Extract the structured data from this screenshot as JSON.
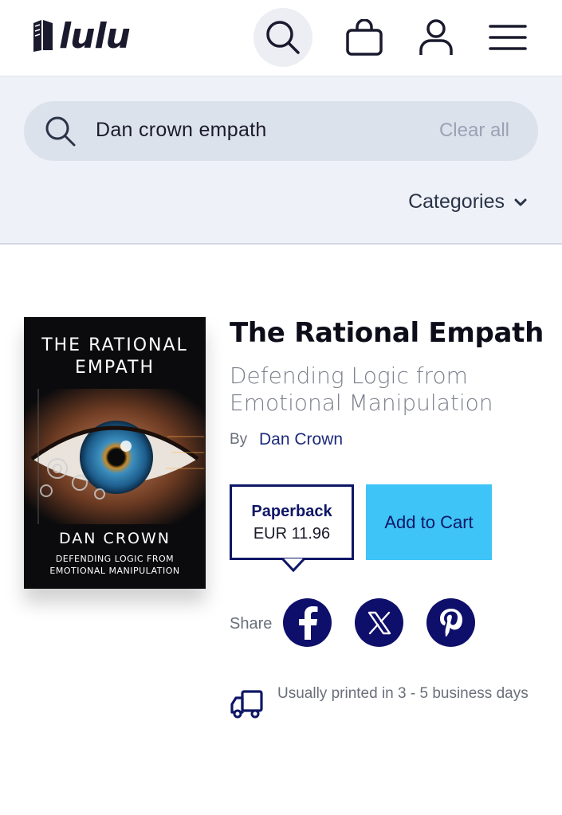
{
  "header": {
    "logo_text": "lulu",
    "icons": [
      "search-icon",
      "shopping-bag-icon",
      "user-icon",
      "hamburger-menu-icon"
    ]
  },
  "search": {
    "value": "Dan crown empath",
    "clear_label": "Clear all",
    "categories_label": "Categories"
  },
  "book": {
    "cover": {
      "title_line1": "THE RATIONAL",
      "title_line2": "EMPATH",
      "author": "DAN CROWN",
      "subtitle_line1": "DEFENDING LOGIC FROM",
      "subtitle_line2": "EMOTIONAL MANIPULATION"
    },
    "title": "The Rational Empath",
    "subtitle": "Defending Logic from Emotional Manipulation",
    "by_label": "By",
    "author": "Dan Crown",
    "format": {
      "label": "Paperback",
      "price": "EUR 11.96"
    },
    "add_to_cart_label": "Add to Cart",
    "share_label": "Share",
    "share_icons": [
      "facebook-icon",
      "x-icon",
      "pinterest-icon"
    ],
    "shipping_text": "Usually printed in 3 - 5 business days"
  },
  "colors": {
    "navy": "#0e1666",
    "cart_button": "#3ec4f6",
    "search_band": "#eef1f7",
    "search_box": "#dce2ec"
  }
}
